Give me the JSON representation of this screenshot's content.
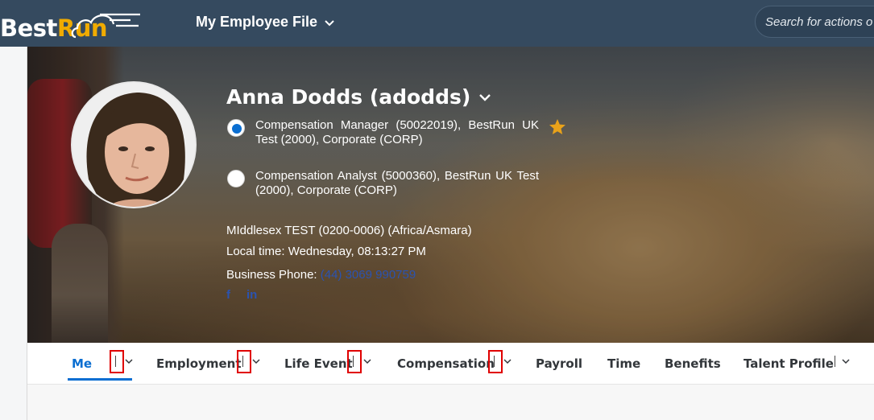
{
  "shell": {
    "logo_best": "Best",
    "logo_run": "Run",
    "app_title": "My Employee File",
    "search_placeholder": "Search for actions o"
  },
  "profile": {
    "name": "Anna Dodds (adodds)",
    "jobs": [
      {
        "text": "Compensation Manager (50022019), BestRun UK Test (2000), Corporate (CORP)",
        "selected": true,
        "favorite": true
      },
      {
        "text": "Compensation Analyst (5000360), BestRun UK Test (2000), Corporate (CORP)",
        "selected": false,
        "favorite": false
      }
    ],
    "location": "MIddlesex TEST (0200-0006) (Africa/Asmara)",
    "local_time": "Local time: Wednesday, 08:13:27 PM",
    "phone_label": "Business Phone:",
    "phone_number": "(44) 3069 990759",
    "social": [
      "f",
      "in"
    ]
  },
  "tabs": [
    {
      "label": "Me",
      "active": true,
      "has_menu": true
    },
    {
      "label": "Employment",
      "active": false,
      "has_menu": true
    },
    {
      "label": "Life Event",
      "active": false,
      "has_menu": true
    },
    {
      "label": "Compensation",
      "active": false,
      "has_menu": true
    },
    {
      "label": "Payroll",
      "active": false,
      "has_menu": false
    },
    {
      "label": "Time",
      "active": false,
      "has_menu": false
    },
    {
      "label": "Benefits",
      "active": false,
      "has_menu": false
    },
    {
      "label": "Talent Profile",
      "active": false,
      "has_menu": true
    }
  ],
  "colors": {
    "shell_bg": "#354a5f",
    "brand_orange": "#f0ab00",
    "accent_blue": "#0a6ed1",
    "link_blue": "#2b53b0",
    "highlight_red": "#e00000",
    "star": "#e9a21a"
  },
  "icons": {
    "app_title": "chevron-down-icon",
    "name": "chevron-down-icon",
    "favorite": "star-icon",
    "tab_menu": "chevron-down-icon"
  }
}
